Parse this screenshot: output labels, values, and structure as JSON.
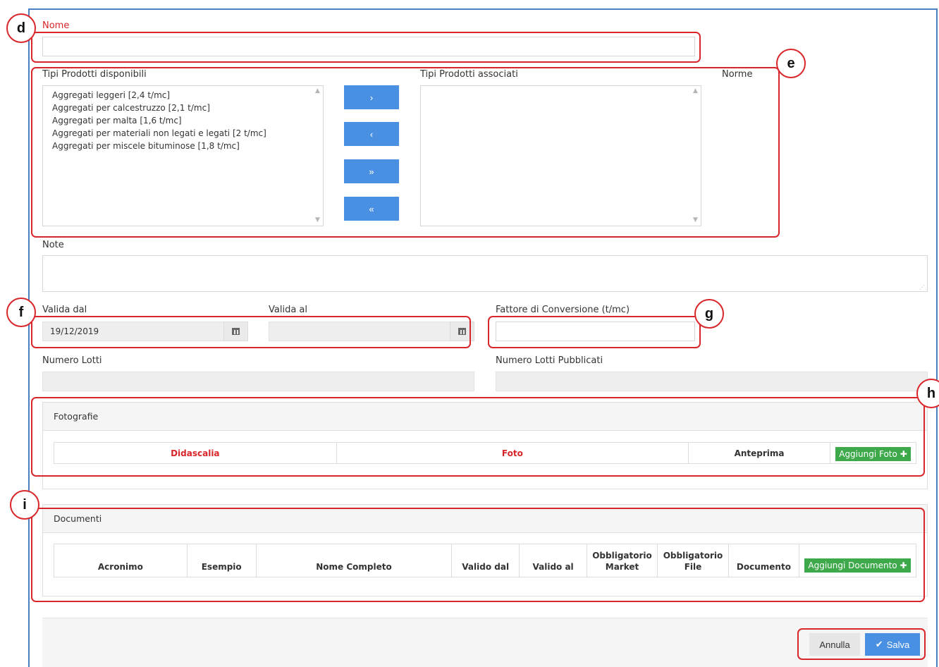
{
  "form": {
    "nome_label": "Nome",
    "nome_value": "",
    "available_label": "Tipi Prodotti disponibili",
    "available_items": [
      "Aggregati leggeri [2,4 t/mc]",
      "Aggregati per calcestruzzo [2,1 t/mc]",
      "Aggregati per malta [1,6 t/mc]",
      "Aggregati per materiali non legati e legati [2 t/mc]",
      "Aggregati per miscele bituminose [1,8 t/mc]"
    ],
    "associated_label": "Tipi Prodotti associati",
    "norme_label": "Norme",
    "move_buttons": {
      "right": "›",
      "left": "‹",
      "all_right": "»",
      "all_left": "«"
    },
    "note_label": "Note",
    "valida_dal_label": "Valida dal",
    "valida_dal_value": "19/12/2019",
    "valida_al_label": "Valida al",
    "valida_al_value": "",
    "fattore_label": "Fattore di Conversione (t/mc)",
    "fattore_value": "",
    "numero_lotti_label": "Numero Lotti",
    "numero_lotti_pubblicati_label": "Numero Lotti Pubblicati"
  },
  "fotografie": {
    "title": "Fotografie",
    "columns": [
      "Didascalia",
      "Foto",
      "Anteprima"
    ],
    "add_button": "Aggiungi Foto"
  },
  "documenti": {
    "title": "Documenti",
    "columns": [
      "Acronimo",
      "Esempio",
      "Nome Completo",
      "Valido dal",
      "Valido al",
      "Obbligatorio Market",
      "Obbligatorio File",
      "Documento"
    ],
    "add_button": "Aggiungi Documento"
  },
  "footer": {
    "cancel": "Annulla",
    "save": "Salva"
  },
  "callouts": [
    "d",
    "e",
    "f",
    "g",
    "h",
    "i"
  ],
  "colors": {
    "primary": "#4a90e2",
    "success": "#3ea94a",
    "required": "#d9262a",
    "callout": "#d9262a"
  }
}
